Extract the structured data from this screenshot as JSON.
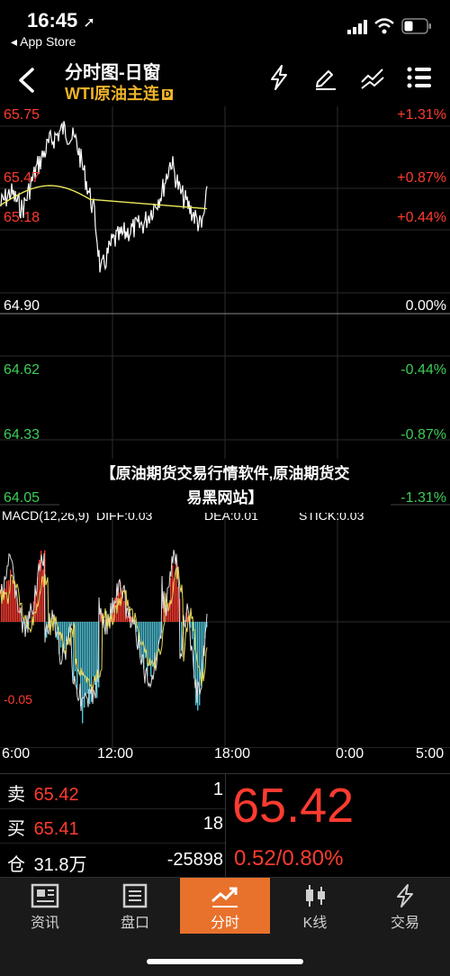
{
  "status_bar": {
    "time": "16:45",
    "location_arrow": "➚",
    "back_app": "◂ App Store"
  },
  "header": {
    "title": "分时图-日窗",
    "subtitle": "WTI原油主连",
    "badge": "D"
  },
  "price_chart": {
    "price_labels": [
      "65.75",
      "65.47",
      "65.18",
      "64.90",
      "64.62",
      "64.33",
      "64.05"
    ],
    "pct_labels": [
      "+1.31%",
      "+0.87%",
      "+0.44%",
      "0.00%",
      "-0.44%",
      "-0.87%",
      "-1.31%"
    ]
  },
  "banner": {
    "line1": "【原油期货交易行情软件,原油期货交",
    "line2": "易黑网站】"
  },
  "macd": {
    "label": "MACD(12,26,9)",
    "diff": "DIFF:0.03",
    "dea": "DEA:0.01",
    "stick": "STICK:0.03",
    "scale_label": "-0.05"
  },
  "time_axis": [
    "6:00",
    "12:00",
    "18:00",
    "0:00",
    "5:00"
  ],
  "quote": {
    "sell_label": "卖",
    "sell_price": "65.42",
    "sell_qty": "1",
    "buy_label": "买",
    "buy_price": "65.41",
    "buy_qty": "18",
    "pos_label": "仓",
    "pos_value": "31.8万",
    "pos_change": "-25898",
    "last_price": "65.42",
    "change": "0.52/0.80%"
  },
  "tabs": [
    {
      "label": "资讯",
      "icon": "news-icon"
    },
    {
      "label": "盘口",
      "icon": "orderbook-icon"
    },
    {
      "label": "分时",
      "icon": "timeshare-icon",
      "active": true
    },
    {
      "label": "K线",
      "icon": "candlestick-icon"
    },
    {
      "label": "交易",
      "icon": "trade-icon"
    }
  ],
  "colors": {
    "up": "#ff3b30",
    "down": "#3ccc57",
    "accent": "#e8712c",
    "avg_line": "#e8e85a",
    "macd_neg": "#4fc3d9"
  }
}
